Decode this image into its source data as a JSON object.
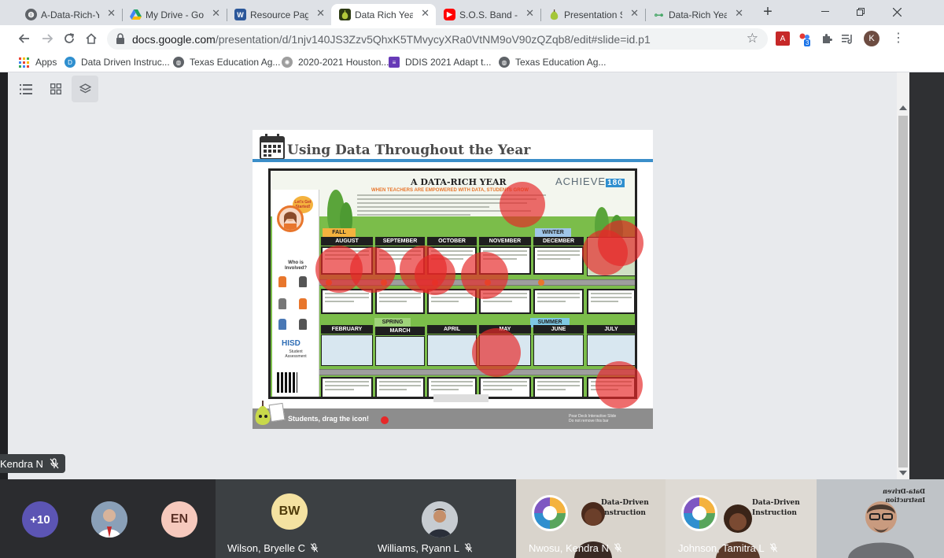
{
  "browser": {
    "tabs": [
      {
        "label": "A-Data-Rich-Yea",
        "icon": "globe-icon",
        "color": "#5f6368"
      },
      {
        "label": "My Drive - Goog",
        "icon": "drive-icon",
        "color": "#1fa463"
      },
      {
        "label": "Resource Page",
        "icon": "word-icon",
        "color": "#2b579a"
      },
      {
        "label": "Data Rich Year I",
        "icon": "pear-deck-icon",
        "color": "#b2c93b"
      },
      {
        "label": "S.O.S. Band - Ta",
        "icon": "youtube-icon",
        "color": "#ff0000"
      },
      {
        "label": "Presentation Se",
        "icon": "pear-icon",
        "color": "#a4c639"
      },
      {
        "label": "Data-Rich Year d",
        "icon": "pear-link-icon",
        "color": "#4aa86a"
      }
    ],
    "active_tab_index": 3,
    "url_host": "docs.google.com",
    "url_path": "/presentation/d/1njv140JS3Zzv5QhxK5TMvycyXRa0VtNM9oV90zQZqb8/edit#slide=id.p1",
    "profile_initial": "K",
    "extension_badge": "3"
  },
  "bookmarks": [
    {
      "label": "Apps",
      "icon": "apps-grid-icon"
    },
    {
      "label": "Data Driven Instruc...",
      "icon": "ddi-icon"
    },
    {
      "label": "Texas Education Ag...",
      "icon": "globe-icon"
    },
    {
      "label": "2020-2021 Houston...",
      "icon": "hisd-icon"
    },
    {
      "label": "DDIS 2021 Adapt t...",
      "icon": "forms-icon"
    },
    {
      "label": "Texas Education Ag...",
      "icon": "globe-icon"
    }
  ],
  "slide": {
    "title": "Using Data Throughout the Year",
    "infographic_heading": "A DATA-RICH YEAR",
    "infographic_subheading": "WHEN TEACHERS ARE EMPOWERED WITH DATA, STUDENTS GROW",
    "brand_name": "ACHIEVE",
    "brand_number": "180",
    "speech_bubble": "Let's Get Started!",
    "who_label": "Who is Involved?",
    "hisd_logo": "HISD",
    "hisd_subtitle": "Student Assessment",
    "seasons": [
      "FALL",
      "WINTER",
      "SPRING",
      "SUMMER"
    ],
    "months_top": [
      "AUGUST",
      "SEPTEMBER",
      "OCTOBER",
      "NOVEMBER",
      "DECEMBER"
    ],
    "months_bottom": [
      "FEBRUARY",
      "MARCH",
      "APRIL",
      "MAY",
      "JUNE",
      "JULY"
    ],
    "footer_prompt": "Students, drag the icon!",
    "footer_right_line1": "Pear Deck Interactive Slide",
    "footer_right_line2": "Do not remove this bar"
  },
  "participants": {
    "pinned_name": "Kendra N",
    "more_count": "+10",
    "tiles": [
      {
        "initials": "EN",
        "name": ""
      },
      {
        "initials": "BW",
        "name": "Wilson, Bryelle C"
      },
      {
        "initials": "",
        "name": "Williams, Ryann L"
      },
      {
        "initials": "",
        "name": "Nwosu, Kendra N"
      },
      {
        "initials": "",
        "name": "Johnson, Tamitra L"
      }
    ],
    "ddi_label_line1": "Data-Driven",
    "ddi_label_line2": "Instruction"
  }
}
